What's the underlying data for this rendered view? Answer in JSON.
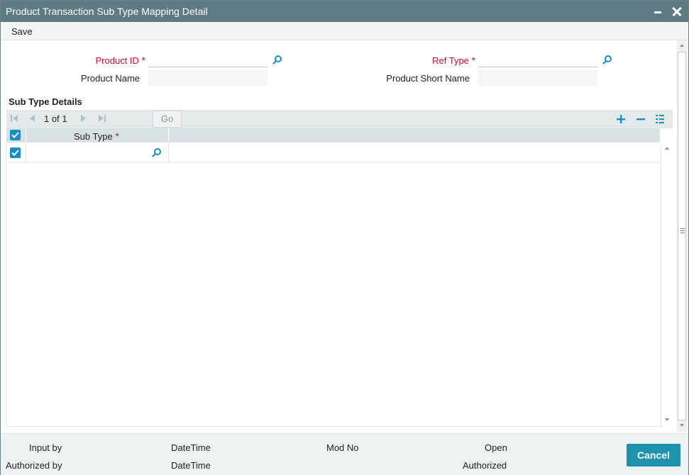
{
  "window": {
    "title": "Product Transaction Sub Type Mapping Detail"
  },
  "menu": {
    "save_label": "Save"
  },
  "form": {
    "product_id": {
      "label": "Product ID",
      "required_mark": "*",
      "value": ""
    },
    "ref_type": {
      "label": "Ref Type",
      "required_mark": "*",
      "value": ""
    },
    "product_name": {
      "label": "Product Name",
      "value": ""
    },
    "product_short_name": {
      "label": "Product Short Name",
      "value": ""
    }
  },
  "grid": {
    "section_title": "Sub Type Details",
    "pager": {
      "current": "1",
      "of_label": "of",
      "total": "1"
    },
    "go_label": "Go",
    "columns": [
      {
        "label": "Sub Type",
        "required_mark": "*"
      }
    ],
    "rows": [
      {
        "sub_type": "",
        "checked": true
      }
    ],
    "header_checked": true
  },
  "footer": {
    "input_by": "Input by",
    "authorized_by": "Authorized by",
    "datetime_1": "DateTime",
    "datetime_2": "DateTime",
    "mod_no": "Mod No",
    "open": "Open",
    "authorized": "Authorized",
    "cancel_label": "Cancel"
  },
  "colors": {
    "titlebar": "#5e7a83",
    "accent": "#1a8fbf",
    "required": "#c8102e",
    "cancel": "#1d93ad"
  }
}
